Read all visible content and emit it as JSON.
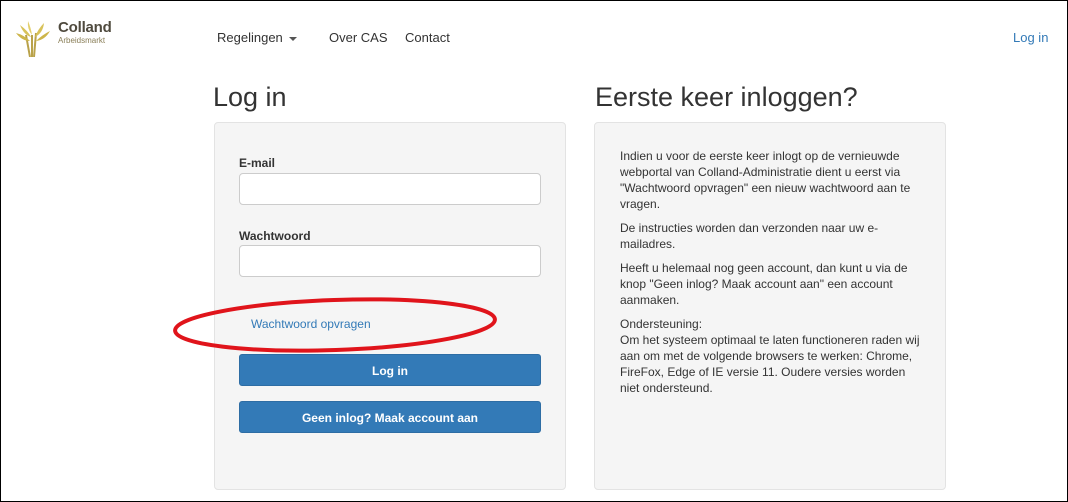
{
  "brand": {
    "name": "Colland",
    "subtitle": "Arbeidsmarkt"
  },
  "nav": {
    "items": [
      {
        "label": "Regelingen",
        "has_dropdown": true
      },
      {
        "label": "Over CAS"
      },
      {
        "label": "Contact"
      }
    ],
    "login": "Log in"
  },
  "login_panel": {
    "heading": "Log in",
    "email_label": "E-mail",
    "email_value": "",
    "password_label": "Wachtwoord",
    "password_value": "",
    "forgot_link": "Wachtwoord opvragen",
    "login_button": "Log in",
    "register_button": "Geen inlog? Maak account aan"
  },
  "info_panel": {
    "heading": "Eerste keer inloggen?",
    "paragraphs": [
      "Indien u voor de eerste keer inlogt op de vernieuwde webportal van Colland-Administratie dient u eerst via \"Wachtwoord opvragen\" een nieuw wachtwoord aan te vragen.",
      "De instructies worden dan verzonden naar uw e-mailadres.",
      "Heeft u helemaal nog geen account, dan kunt u via de knop \"Geen inlog? Maak account aan\" een account aanmaken.",
      "Ondersteuning:",
      "Om het systeem optimaal te laten functioneren raden wij aan om met de volgende browsers te werken: Chrome, FireFox, Edge of IE versie 11. Oudere versies worden niet ondersteund."
    ]
  },
  "colors": {
    "primary": "#337ab7",
    "annotation": "#e0141b",
    "well_bg": "#f5f5f5"
  }
}
